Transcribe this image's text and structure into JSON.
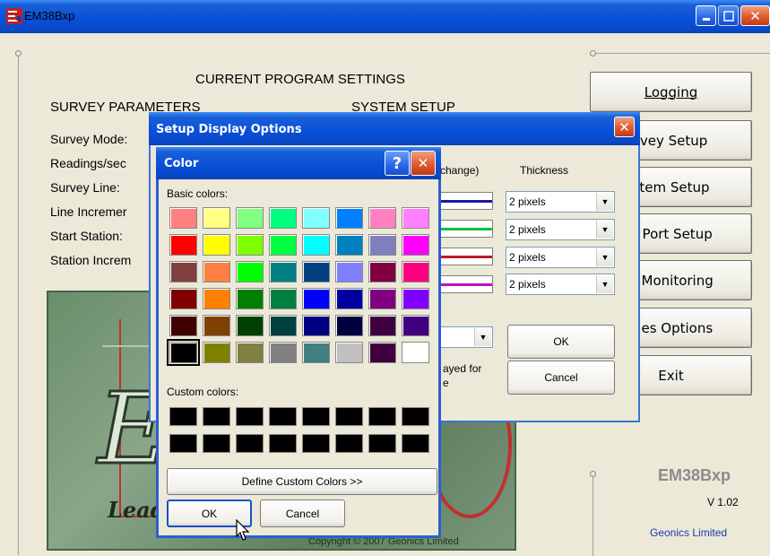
{
  "main": {
    "title": "EM38Bxp",
    "heading": "CURRENT PROGRAM SETTINGS",
    "survey_params_heading": "SURVEY PARAMETERS",
    "system_setup_heading": "SYSTEM SETUP",
    "params": [
      "Survey Mode:",
      "Readings/sec",
      "Survey Line:",
      "Line Incremer",
      "Start Station:",
      "Station Increm"
    ],
    "logo_text": "Lead",
    "copyright": "Copyright © 2007 Geonics Limited",
    "brand": "EM38Bxp",
    "version": "V 1.02",
    "company": "Geonics Limited",
    "buttons": {
      "logging": "Logging",
      "survey_setup": "rvey Setup",
      "system_setup": "stem Setup",
      "port_setup": "S Port Setup",
      "monitoring": "S Monitoring",
      "files_options": "files Options",
      "exit": "Exit"
    }
  },
  "setup_dialog": {
    "title": "Setup Display Options",
    "color_col_partial": "change)",
    "thickness_header": "Thickness",
    "thickness_values": [
      "2 pixels",
      "2 pixels",
      "2 pixels",
      "2 pixels"
    ],
    "line_colors": [
      "#1a1aa0",
      "#10c040",
      "#c01a2a",
      "#c010c0"
    ],
    "note_line1": "ayed for",
    "note_line2": "e",
    "ok": "OK",
    "cancel": "Cancel"
  },
  "color_dialog": {
    "title": "Color",
    "help": "?",
    "basic_colors_label": "Basic colors:",
    "custom_colors_label": "Custom colors:",
    "define_custom": "Define Custom Colors >>",
    "ok": "OK",
    "cancel": "Cancel",
    "basic_colors": [
      [
        "#ff8080",
        "#ffff80",
        "#80ff80",
        "#00ff80",
        "#80ffff",
        "#0080ff",
        "#ff80c0",
        "#ff80ff"
      ],
      [
        "#ff0000",
        "#ffff00",
        "#80ff00",
        "#00ff40",
        "#00ffff",
        "#0080c0",
        "#8080c0",
        "#ff00ff"
      ],
      [
        "#804040",
        "#ff8040",
        "#00ff00",
        "#008080",
        "#004080",
        "#8080ff",
        "#800040",
        "#ff0080"
      ],
      [
        "#800000",
        "#ff8000",
        "#008000",
        "#008040",
        "#0000ff",
        "#0000a0",
        "#800080",
        "#8000ff"
      ],
      [
        "#400000",
        "#804000",
        "#004000",
        "#004040",
        "#000080",
        "#000040",
        "#400040",
        "#400080"
      ],
      [
        "#000000",
        "#808000",
        "#808040",
        "#808080",
        "#408080",
        "#c0c0c0",
        "#400040",
        "#ffffff"
      ]
    ],
    "selected": "#000000"
  },
  "icons": {
    "app_icon": "em38-app-icon",
    "minimize": "minimize-icon",
    "maximize": "maximize-icon",
    "close": "close-icon",
    "dropdown": "chevron-down-icon",
    "cursor": "mouse-pointer-icon"
  }
}
